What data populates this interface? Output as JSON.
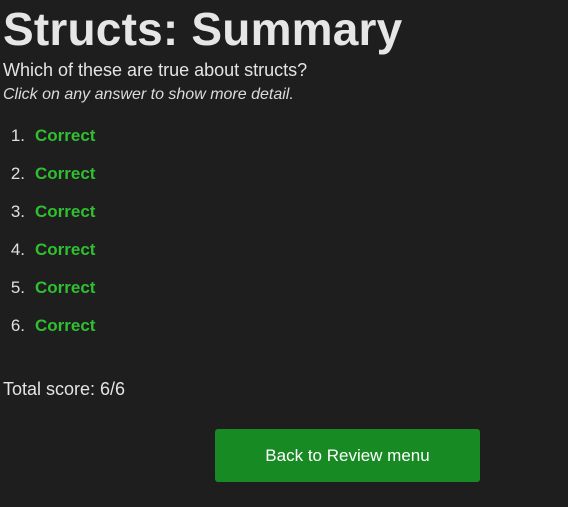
{
  "title": "Structs: Summary",
  "question": "Which of these are true about structs?",
  "hint": "Click on any answer to show more detail.",
  "answers": [
    {
      "number": "1.",
      "status": "Correct"
    },
    {
      "number": "2.",
      "status": "Correct"
    },
    {
      "number": "3.",
      "status": "Correct"
    },
    {
      "number": "4.",
      "status": "Correct"
    },
    {
      "number": "5.",
      "status": "Correct"
    },
    {
      "number": "6.",
      "status": "Correct"
    }
  ],
  "score": "Total score: 6/6",
  "back_button_label": "Back to Review menu",
  "colors": {
    "background": "#1e1e1f",
    "correct": "#2fbf2f",
    "button": "#178a24"
  }
}
